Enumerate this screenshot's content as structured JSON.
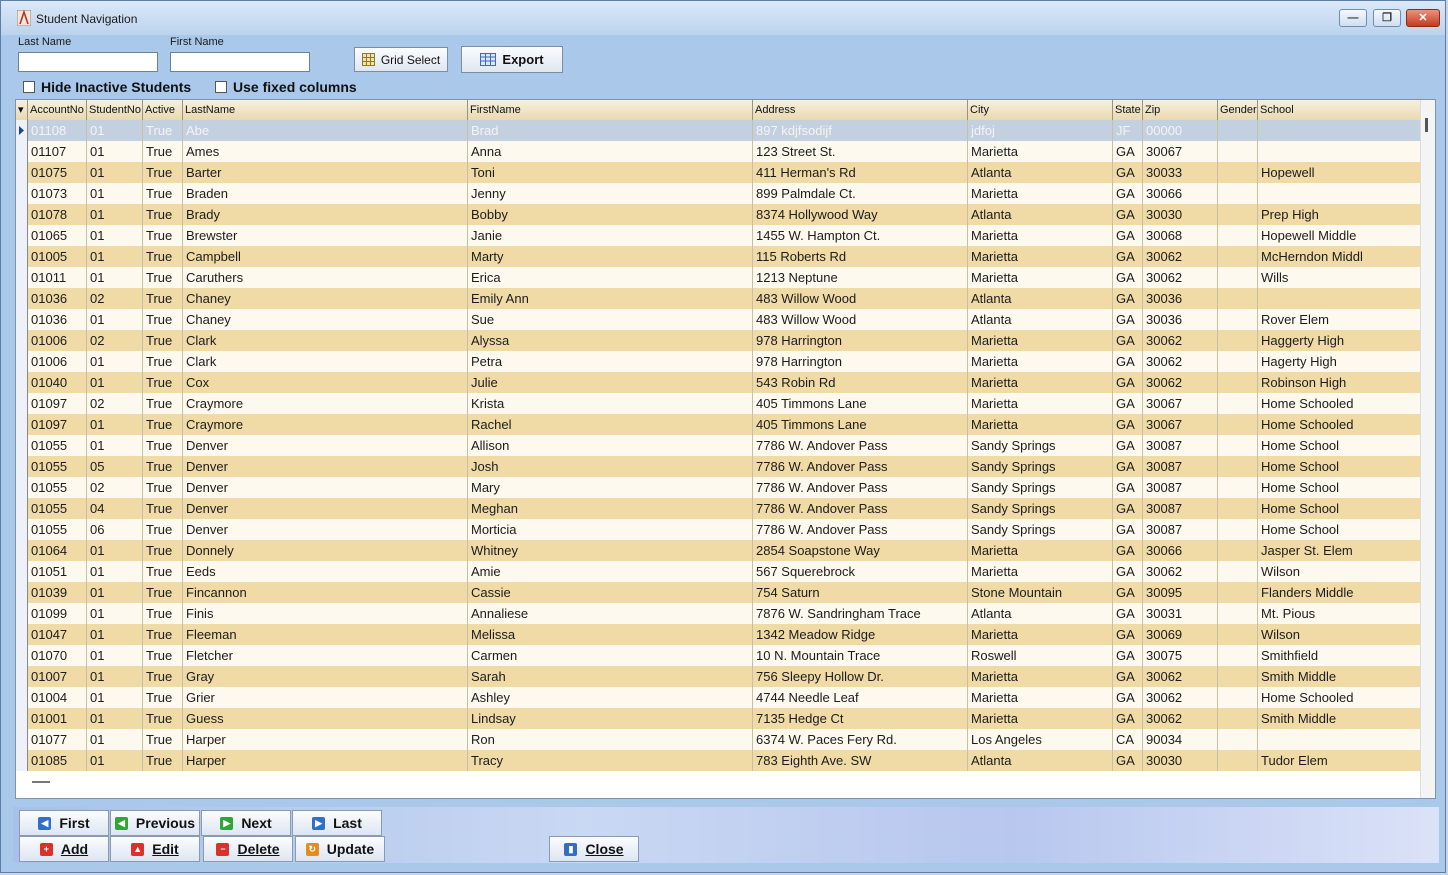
{
  "window": {
    "title": "Student Navigation",
    "controls": [
      "minimize",
      "maximize",
      "close"
    ]
  },
  "search": {
    "last_name_label": "Last Name",
    "first_name_label": "First Name",
    "last_name_value": "",
    "first_name_value": ""
  },
  "toolbar": {
    "grid_select_label": "Grid Select",
    "export_label": "Export"
  },
  "options": {
    "hide_inactive_label": "Hide Inactive Students",
    "fixed_columns_label": "Use fixed columns"
  },
  "grid": {
    "columns": [
      "AccountNo",
      "StudentNo",
      "Active",
      "LastName",
      "FirstName",
      "Address",
      "City",
      "State",
      "Zip",
      "Gender",
      "School"
    ],
    "rows": [
      [
        "01108",
        "01",
        "True",
        "Abe",
        "Brad",
        "897 kdjfsodijf",
        "jdfoj",
        "JF",
        "00000",
        "",
        ""
      ],
      [
        "01107",
        "01",
        "True",
        "Ames",
        "Anna",
        "123 Street St.",
        "Marietta",
        "GA",
        "30067",
        "",
        ""
      ],
      [
        "01075",
        "01",
        "True",
        "Barter",
        "Toni",
        "411 Herman's Rd",
        "Atlanta",
        "GA",
        "30033",
        "",
        "Hopewell"
      ],
      [
        "01073",
        "01",
        "True",
        "Braden",
        "Jenny",
        "899 Palmdale Ct.",
        "Marietta",
        "GA",
        "30066",
        "",
        ""
      ],
      [
        "01078",
        "01",
        "True",
        "Brady",
        "Bobby",
        "8374 Hollywood Way",
        "Atlanta",
        "GA",
        "30030",
        "",
        "Prep High"
      ],
      [
        "01065",
        "01",
        "True",
        "Brewster",
        "Janie",
        "1455 W. Hampton Ct.",
        "Marietta",
        "GA",
        "30068",
        "",
        "Hopewell Middle"
      ],
      [
        "01005",
        "01",
        "True",
        "Campbell",
        "Marty",
        "115 Roberts Rd",
        "Marietta",
        "GA",
        "30062",
        "",
        "McHerndon Middl"
      ],
      [
        "01011",
        "01",
        "True",
        "Caruthers",
        "Erica",
        "1213 Neptune",
        "Marietta",
        "GA",
        "30062",
        "",
        "Wills"
      ],
      [
        "01036",
        "02",
        "True",
        "Chaney",
        "Emily Ann",
        "483 Willow Wood",
        "Atlanta",
        "GA",
        "30036",
        "",
        ""
      ],
      [
        "01036",
        "01",
        "True",
        "Chaney",
        "Sue",
        "483 Willow Wood",
        "Atlanta",
        "GA",
        "30036",
        "",
        "Rover Elem"
      ],
      [
        "01006",
        "02",
        "True",
        "Clark",
        "Alyssa",
        "978 Harrington",
        "Marietta",
        "GA",
        "30062",
        "",
        "Haggerty High"
      ],
      [
        "01006",
        "01",
        "True",
        "Clark",
        "Petra",
        "978 Harrington",
        "Marietta",
        "GA",
        "30062",
        "",
        "Hagerty High"
      ],
      [
        "01040",
        "01",
        "True",
        "Cox",
        "Julie",
        "543 Robin Rd",
        "Marietta",
        "GA",
        "30062",
        "",
        "Robinson High"
      ],
      [
        "01097",
        "02",
        "True",
        "Craymore",
        "Krista",
        "405 Timmons Lane",
        "Marietta",
        "GA",
        "30067",
        "",
        "Home Schooled"
      ],
      [
        "01097",
        "01",
        "True",
        "Craymore",
        "Rachel",
        "405 Timmons Lane",
        "Marietta",
        "GA",
        "30067",
        "",
        "Home Schooled"
      ],
      [
        "01055",
        "01",
        "True",
        "Denver",
        "Allison",
        "7786 W. Andover Pass",
        "Sandy Springs",
        "GA",
        "30087",
        "",
        "Home School"
      ],
      [
        "01055",
        "05",
        "True",
        "Denver",
        "Josh",
        "7786 W. Andover Pass",
        "Sandy Springs",
        "GA",
        "30087",
        "",
        "Home School"
      ],
      [
        "01055",
        "02",
        "True",
        "Denver",
        "Mary",
        "7786 W. Andover Pass",
        "Sandy Springs",
        "GA",
        "30087",
        "",
        "Home School"
      ],
      [
        "01055",
        "04",
        "True",
        "Denver",
        "Meghan",
        "7786 W. Andover Pass",
        "Sandy Springs",
        "GA",
        "30087",
        "",
        "Home School"
      ],
      [
        "01055",
        "06",
        "True",
        "Denver",
        "Morticia",
        "7786 W. Andover Pass",
        "Sandy Springs",
        "GA",
        "30087",
        "",
        "Home School"
      ],
      [
        "01064",
        "01",
        "True",
        "Donnely",
        "Whitney",
        "2854 Soapstone Way",
        "Marietta",
        "GA",
        "30066",
        "",
        "Jasper St. Elem"
      ],
      [
        "01051",
        "01",
        "True",
        "Eeds",
        "Amie",
        "567 Squerebrock",
        "Marietta",
        "GA",
        "30062",
        "",
        "Wilson"
      ],
      [
        "01039",
        "01",
        "True",
        "Fincannon",
        "Cassie",
        "754 Saturn",
        "Stone Mountain",
        "GA",
        "30095",
        "",
        "Flanders Middle"
      ],
      [
        "01099",
        "01",
        "True",
        "Finis",
        "Annaliese",
        "7876 W. Sandringham Trace",
        "Atlanta",
        "GA",
        "30031",
        "",
        "Mt. Pious"
      ],
      [
        "01047",
        "01",
        "True",
        "Fleeman",
        "Melissa",
        "1342 Meadow Ridge",
        "Marietta",
        "GA",
        "30069",
        "",
        "Wilson"
      ],
      [
        "01070",
        "01",
        "True",
        "Fletcher",
        "Carmen",
        "10 N. Mountain Trace",
        "Roswell",
        "GA",
        "30075",
        "",
        "Smithfield"
      ],
      [
        "01007",
        "01",
        "True",
        "Gray",
        "Sarah",
        "756 Sleepy Hollow Dr.",
        "Marietta",
        "GA",
        "30062",
        "",
        "Smith Middle"
      ],
      [
        "01004",
        "01",
        "True",
        "Grier",
        "Ashley",
        "4744 Needle Leaf",
        "Marietta",
        "GA",
        "30062",
        "",
        "Home Schooled"
      ],
      [
        "01001",
        "01",
        "True",
        "Guess",
        "Lindsay",
        "7135 Hedge Ct",
        "Marietta",
        "GA",
        "30062",
        "",
        "Smith Middle"
      ],
      [
        "01077",
        "01",
        "True",
        "Harper",
        "Ron",
        "6374 W. Paces Fery Rd.",
        "Los Angeles",
        "CA",
        "90034",
        "",
        ""
      ],
      [
        "01085",
        "01",
        "True",
        "Harper",
        "Tracy",
        "783 Eighth Ave. SW",
        "Atlanta",
        "GA",
        "30030",
        "",
        "Tudor Elem"
      ]
    ]
  },
  "nav": {
    "first": "First",
    "previous": "Previous",
    "next": "Next",
    "last": "Last"
  },
  "actions": {
    "add": "Add",
    "edit": "Edit",
    "delete": "Delete",
    "update": "Update",
    "close": "Close"
  }
}
